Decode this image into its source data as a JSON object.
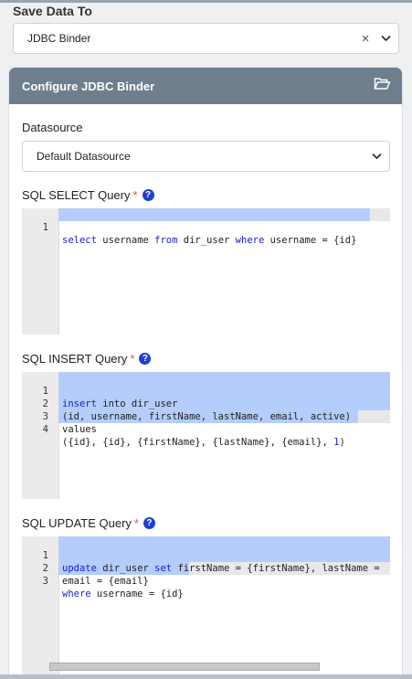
{
  "save_data_to": {
    "label": "Save Data To",
    "value": "JDBC Binder",
    "clear": "×"
  },
  "panel": {
    "title": "Configure JDBC Binder"
  },
  "datasource": {
    "label": "Datasource",
    "value": "Default Datasource"
  },
  "select_query": {
    "label": "SQL SELECT Query",
    "required": "*",
    "help": "?",
    "lines": [
      {
        "num": "1",
        "text": "username {id}"
      }
    ]
  },
  "insert_query": {
    "label": "SQL INSERT Query",
    "required": "*",
    "help": "?",
    "lines": [
      {
        "num": "1"
      },
      {
        "num": "2"
      },
      {
        "num": "3"
      },
      {
        "num": "4"
      }
    ]
  },
  "update_query": {
    "label": "SQL UPDATE Query",
    "required": "*",
    "help": "?",
    "lines": [
      {
        "num": "1"
      },
      {
        "num": "2"
      },
      {
        "num": "3"
      }
    ]
  }
}
